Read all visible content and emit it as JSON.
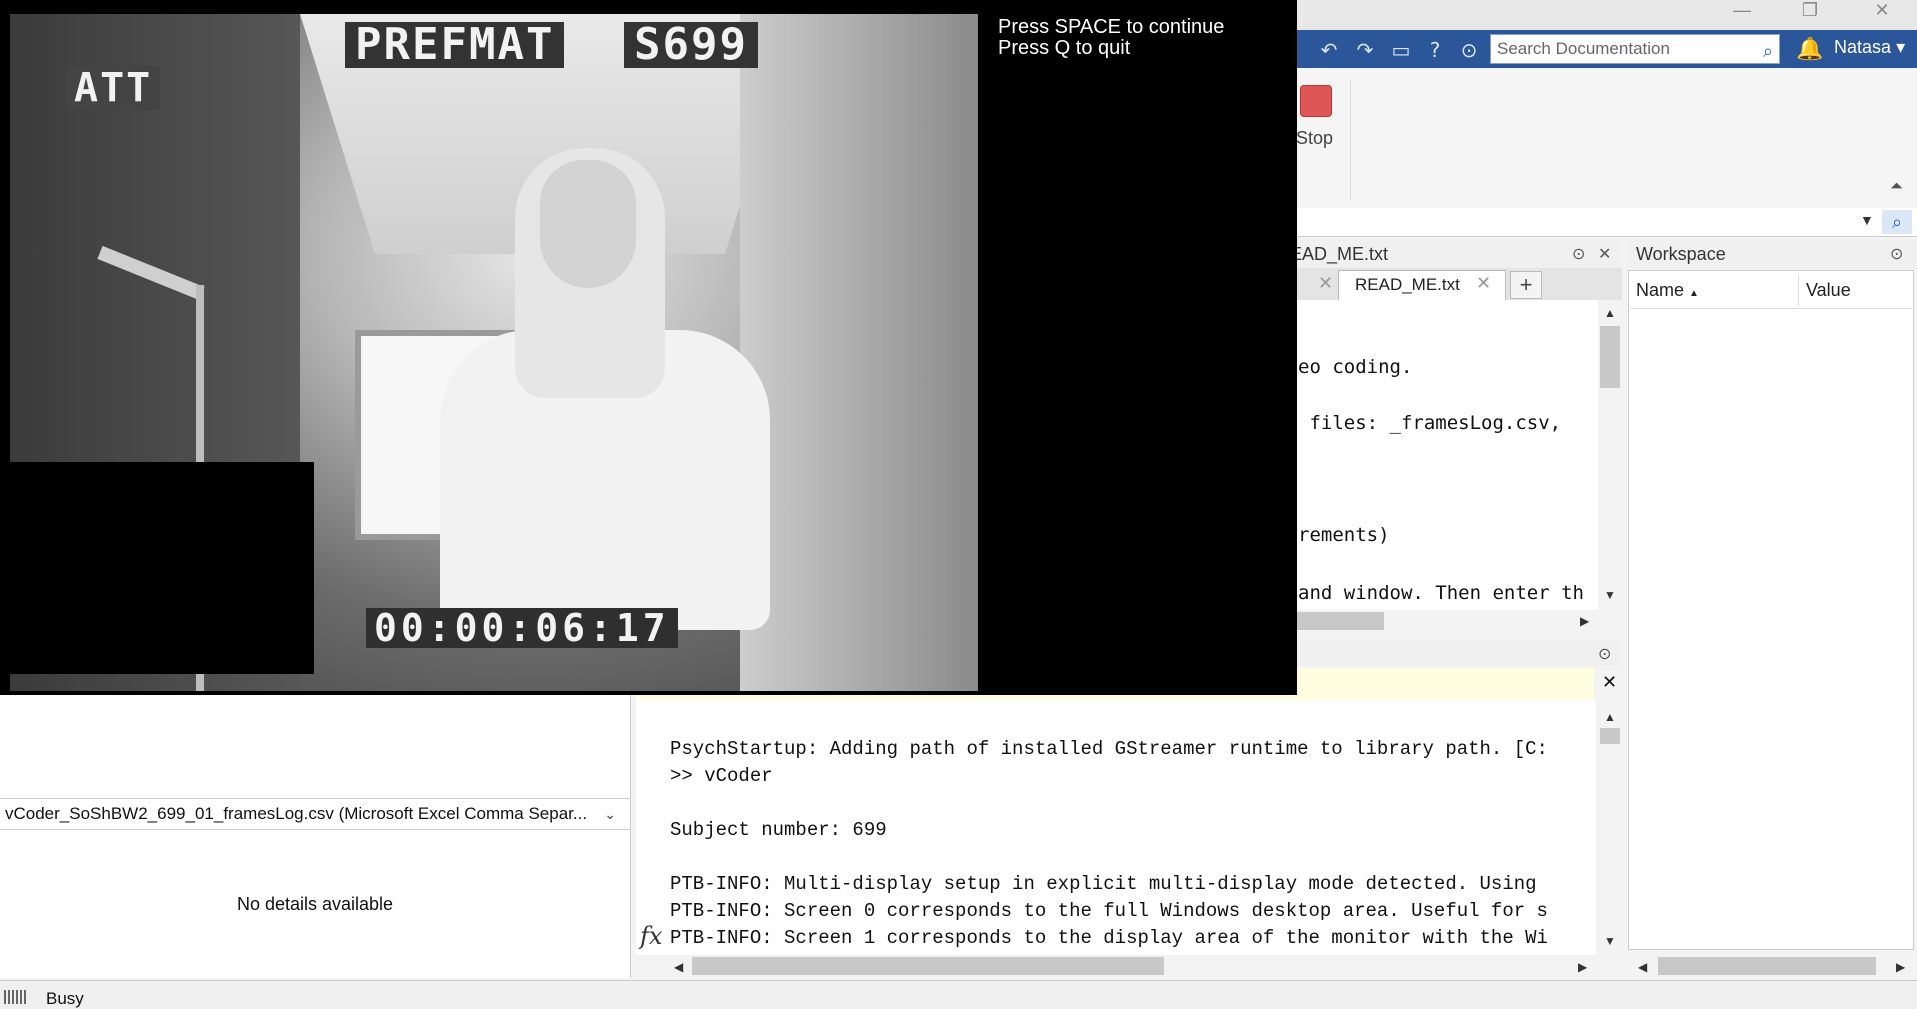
{
  "matlab": {
    "search_placeholder": "Search Documentation",
    "user_name": "Natasa",
    "stop_label": "Stop",
    "editor": {
      "title": "EAD_ME.txt",
      "active_tab": "READ_ME.txt",
      "code_lines": [
        "eo coding.",
        " files: _framesLog.csv,",
        "rements)",
        "and window. Then enter th"
      ]
    },
    "command_window": {
      "lines": [
        "PsychStartup: Adding path of installed GStreamer runtime to library path. [C:",
        ">> vCoder",
        "",
        "Subject number: 699",
        "",
        "PTB-INFO: Multi-display setup in explicit multi-display mode detected. Using ",
        "PTB-INFO: Screen 0 corresponds to the full Windows desktop area. Useful for s",
        "PTB-INFO: Screen 1 corresponds to the display area of the monitor with the Wi"
      ],
      "fx_label": "fx"
    },
    "workspace": {
      "title": "Workspace",
      "col_name": "Name",
      "col_value": "Value"
    },
    "details": {
      "file_selector": "vCoder_SoShBW2_699_01_framesLog.csv  (Microsoft Excel Comma Separ...",
      "no_details": "No details available"
    },
    "status": "Busy"
  },
  "video": {
    "overlay_title": "PREFMAT",
    "overlay_subject": "S699",
    "overlay_condition": "ATT",
    "timecode": "00:00:06:17",
    "instruction_1": "Press SPACE to continue",
    "instruction_2": "Press Q to quit"
  },
  "icons": [
    "undo-icon",
    "redo-icon",
    "window-icon",
    "help-icon",
    "dropdown-icon",
    "search-icon",
    "bell-icon",
    "chevron-down-icon",
    "minimize-icon",
    "restore-icon",
    "close-icon"
  ]
}
